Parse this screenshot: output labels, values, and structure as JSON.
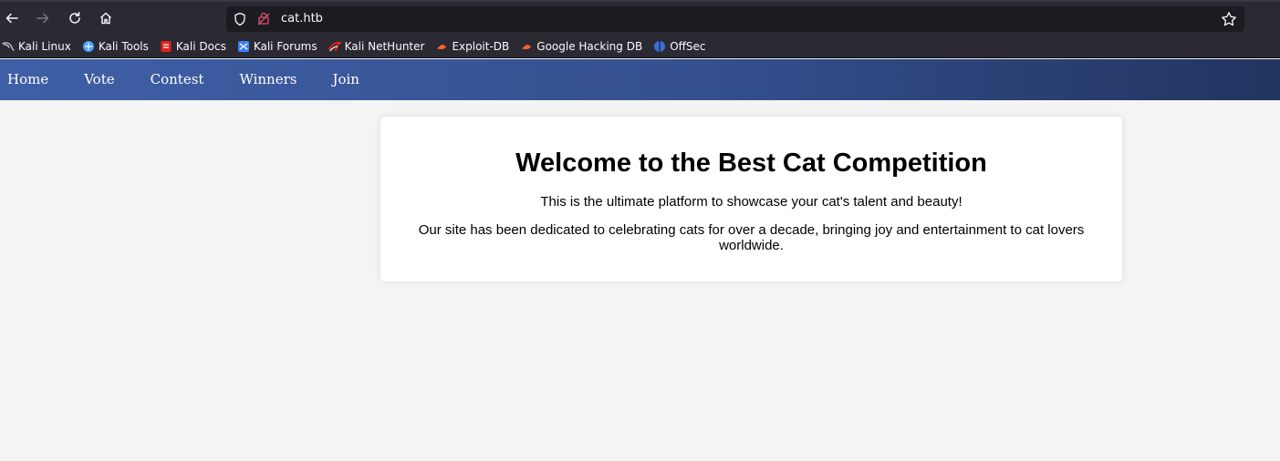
{
  "browser": {
    "url": "cat.htb",
    "bookmarks": [
      {
        "label": "Kali Linux",
        "icon": "kali-dragon-icon",
        "color": "#c7c7c7"
      },
      {
        "label": "Kali Tools",
        "icon": "kali-tools-icon",
        "color": "#4aa3ff"
      },
      {
        "label": "Kali Docs",
        "icon": "kali-docs-icon",
        "color": "#e2231a"
      },
      {
        "label": "Kali Forums",
        "icon": "kali-forums-icon",
        "color": "#3b82f6"
      },
      {
        "label": "Kali NetHunter",
        "icon": "kali-nethunter-icon",
        "color": "#e2231a"
      },
      {
        "label": "Exploit-DB",
        "icon": "exploit-db-icon",
        "color": "#f2652a"
      },
      {
        "label": "Google Hacking DB",
        "icon": "ghdb-icon",
        "color": "#f2652a"
      },
      {
        "label": "OffSec",
        "icon": "offsec-icon",
        "color": "#3a6fd8"
      }
    ]
  },
  "nav": {
    "items": [
      "Home",
      "Vote",
      "Contest",
      "Winners",
      "Join"
    ]
  },
  "main": {
    "title": "Welcome to the Best Cat Competition",
    "intro": "This is the ultimate platform to showcase your cat's talent and beauty!",
    "description": "Our site has been dedicated to celebrating cats for over a decade, bringing joy and entertainment to cat lovers worldwide."
  },
  "colors": {
    "nav_gradient_start": "#3f5fa6",
    "nav_gradient_end": "#22345f",
    "page_background": "#f4f4f4",
    "card_background": "#ffffff"
  }
}
